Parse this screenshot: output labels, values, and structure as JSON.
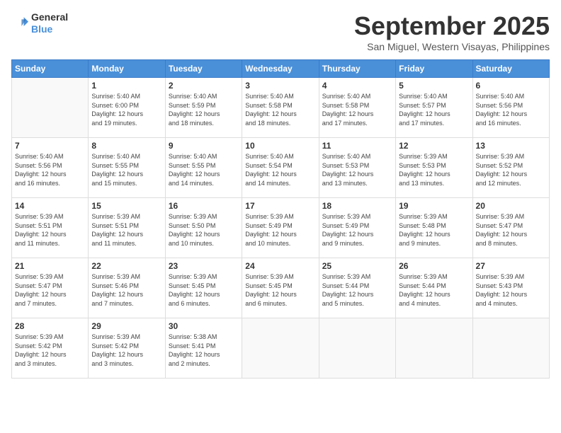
{
  "header": {
    "logo_line1": "General",
    "logo_line2": "Blue",
    "month": "September 2025",
    "location": "San Miguel, Western Visayas, Philippines"
  },
  "days_of_week": [
    "Sunday",
    "Monday",
    "Tuesday",
    "Wednesday",
    "Thursday",
    "Friday",
    "Saturday"
  ],
  "weeks": [
    [
      {
        "day": "",
        "info": ""
      },
      {
        "day": "1",
        "info": "Sunrise: 5:40 AM\nSunset: 6:00 PM\nDaylight: 12 hours\nand 19 minutes."
      },
      {
        "day": "2",
        "info": "Sunrise: 5:40 AM\nSunset: 5:59 PM\nDaylight: 12 hours\nand 18 minutes."
      },
      {
        "day": "3",
        "info": "Sunrise: 5:40 AM\nSunset: 5:58 PM\nDaylight: 12 hours\nand 18 minutes."
      },
      {
        "day": "4",
        "info": "Sunrise: 5:40 AM\nSunset: 5:58 PM\nDaylight: 12 hours\nand 17 minutes."
      },
      {
        "day": "5",
        "info": "Sunrise: 5:40 AM\nSunset: 5:57 PM\nDaylight: 12 hours\nand 17 minutes."
      },
      {
        "day": "6",
        "info": "Sunrise: 5:40 AM\nSunset: 5:56 PM\nDaylight: 12 hours\nand 16 minutes."
      }
    ],
    [
      {
        "day": "7",
        "info": "Sunrise: 5:40 AM\nSunset: 5:56 PM\nDaylight: 12 hours\nand 16 minutes."
      },
      {
        "day": "8",
        "info": "Sunrise: 5:40 AM\nSunset: 5:55 PM\nDaylight: 12 hours\nand 15 minutes."
      },
      {
        "day": "9",
        "info": "Sunrise: 5:40 AM\nSunset: 5:55 PM\nDaylight: 12 hours\nand 14 minutes."
      },
      {
        "day": "10",
        "info": "Sunrise: 5:40 AM\nSunset: 5:54 PM\nDaylight: 12 hours\nand 14 minutes."
      },
      {
        "day": "11",
        "info": "Sunrise: 5:40 AM\nSunset: 5:53 PM\nDaylight: 12 hours\nand 13 minutes."
      },
      {
        "day": "12",
        "info": "Sunrise: 5:39 AM\nSunset: 5:53 PM\nDaylight: 12 hours\nand 13 minutes."
      },
      {
        "day": "13",
        "info": "Sunrise: 5:39 AM\nSunset: 5:52 PM\nDaylight: 12 hours\nand 12 minutes."
      }
    ],
    [
      {
        "day": "14",
        "info": "Sunrise: 5:39 AM\nSunset: 5:51 PM\nDaylight: 12 hours\nand 11 minutes."
      },
      {
        "day": "15",
        "info": "Sunrise: 5:39 AM\nSunset: 5:51 PM\nDaylight: 12 hours\nand 11 minutes."
      },
      {
        "day": "16",
        "info": "Sunrise: 5:39 AM\nSunset: 5:50 PM\nDaylight: 12 hours\nand 10 minutes."
      },
      {
        "day": "17",
        "info": "Sunrise: 5:39 AM\nSunset: 5:49 PM\nDaylight: 12 hours\nand 10 minutes."
      },
      {
        "day": "18",
        "info": "Sunrise: 5:39 AM\nSunset: 5:49 PM\nDaylight: 12 hours\nand 9 minutes."
      },
      {
        "day": "19",
        "info": "Sunrise: 5:39 AM\nSunset: 5:48 PM\nDaylight: 12 hours\nand 9 minutes."
      },
      {
        "day": "20",
        "info": "Sunrise: 5:39 AM\nSunset: 5:47 PM\nDaylight: 12 hours\nand 8 minutes."
      }
    ],
    [
      {
        "day": "21",
        "info": "Sunrise: 5:39 AM\nSunset: 5:47 PM\nDaylight: 12 hours\nand 7 minutes."
      },
      {
        "day": "22",
        "info": "Sunrise: 5:39 AM\nSunset: 5:46 PM\nDaylight: 12 hours\nand 7 minutes."
      },
      {
        "day": "23",
        "info": "Sunrise: 5:39 AM\nSunset: 5:45 PM\nDaylight: 12 hours\nand 6 minutes."
      },
      {
        "day": "24",
        "info": "Sunrise: 5:39 AM\nSunset: 5:45 PM\nDaylight: 12 hours\nand 6 minutes."
      },
      {
        "day": "25",
        "info": "Sunrise: 5:39 AM\nSunset: 5:44 PM\nDaylight: 12 hours\nand 5 minutes."
      },
      {
        "day": "26",
        "info": "Sunrise: 5:39 AM\nSunset: 5:44 PM\nDaylight: 12 hours\nand 4 minutes."
      },
      {
        "day": "27",
        "info": "Sunrise: 5:39 AM\nSunset: 5:43 PM\nDaylight: 12 hours\nand 4 minutes."
      }
    ],
    [
      {
        "day": "28",
        "info": "Sunrise: 5:39 AM\nSunset: 5:42 PM\nDaylight: 12 hours\nand 3 minutes."
      },
      {
        "day": "29",
        "info": "Sunrise: 5:39 AM\nSunset: 5:42 PM\nDaylight: 12 hours\nand 3 minutes."
      },
      {
        "day": "30",
        "info": "Sunrise: 5:38 AM\nSunset: 5:41 PM\nDaylight: 12 hours\nand 2 minutes."
      },
      {
        "day": "",
        "info": ""
      },
      {
        "day": "",
        "info": ""
      },
      {
        "day": "",
        "info": ""
      },
      {
        "day": "",
        "info": ""
      }
    ]
  ]
}
